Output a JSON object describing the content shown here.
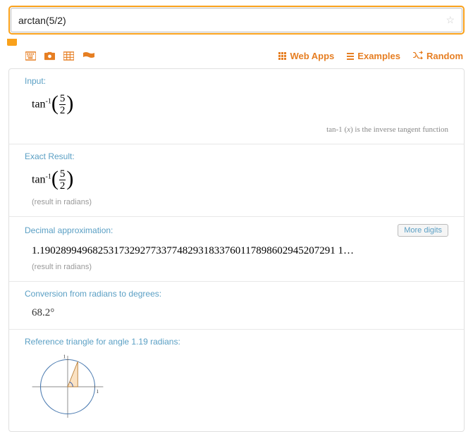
{
  "search": {
    "value": "arctan(5/2)"
  },
  "nav": {
    "webapps": "Web Apps",
    "examples": "Examples",
    "random": "Random"
  },
  "sections": {
    "input": {
      "title": "Input:",
      "expr_fn": "tan",
      "expr_sup": "-1",
      "expr_num": "5",
      "expr_den": "2",
      "annot_fn": "tan",
      "annot_sup": "-1",
      "annot_var": "x",
      "annot_desc": "is the inverse tangent function"
    },
    "exact": {
      "title": "Exact Result:",
      "expr_fn": "tan",
      "expr_sup": "-1",
      "expr_num": "5",
      "expr_den": "2",
      "subnote": "(result in radians)"
    },
    "decimal": {
      "title": "Decimal approximation:",
      "value": "1.19028994968253173292773377482931833760117898602945207291 1…",
      "subnote": "(result in radians)",
      "more_btn": "More digits"
    },
    "degrees": {
      "title": "Conversion from radians to degrees:",
      "value": "68.2°"
    },
    "triangle": {
      "title": "Reference triangle for angle 1.19 radians:",
      "axis_label": "1"
    }
  },
  "chart_data": {
    "type": "diagram",
    "description": "Unit circle with reference right triangle for angle ≈1.19 rad (≈68.2°)",
    "triangle_vertices": [
      [
        0,
        0
      ],
      [
        0.371,
        0
      ],
      [
        0.371,
        0.928
      ]
    ],
    "circle_radius": 1,
    "xlim": [
      -1.2,
      1.2
    ],
    "ylim": [
      -1.2,
      1.2
    ],
    "tick_label": "1"
  }
}
